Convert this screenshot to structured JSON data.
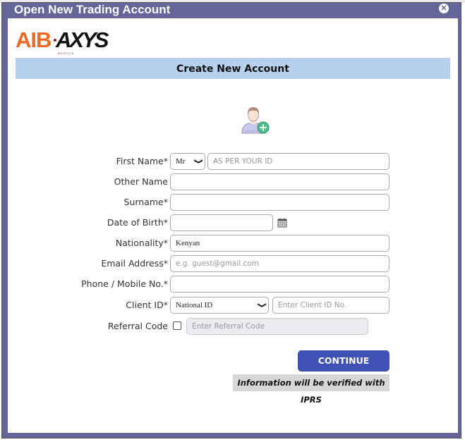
{
  "modal": {
    "title": "Open New Trading Account",
    "close_icon": "close-circle-icon"
  },
  "logo": {
    "part1": "AIB",
    "part2": "AXYS",
    "tagline": "AFRICA",
    "colors": {
      "orange": "#ee6a24",
      "dark": "#111111"
    }
  },
  "header": {
    "title": "Create New Account"
  },
  "avatar": {
    "icon": "add-user-icon"
  },
  "form": {
    "first_name": {
      "label": "First Name*",
      "title_value": "Mr",
      "placeholder": "AS PER YOUR ID",
      "value": ""
    },
    "other_name": {
      "label": "Other Name",
      "value": ""
    },
    "surname": {
      "label": "Surname*",
      "value": ""
    },
    "dob": {
      "label": "Date of Birth*",
      "value": "",
      "icon": "calendar-icon"
    },
    "nationality": {
      "label": "Nationality*",
      "value": "Kenyan"
    },
    "email": {
      "label": "Email Address*",
      "placeholder": "e.g. guest@gmail.com",
      "value": ""
    },
    "phone": {
      "label": "Phone / Mobile No.*",
      "value": ""
    },
    "client_id": {
      "label": "Client ID*",
      "type_value": "National ID",
      "placeholder": "Enter Client ID No.",
      "value": ""
    },
    "referral": {
      "label": "Referral Code",
      "checked": false,
      "placeholder": "Enter Referral Code"
    }
  },
  "actions": {
    "continue_label": "CONTINUE",
    "note": "Information will be verified with IPRS"
  },
  "colors": {
    "frame": "#65659a",
    "header_bg": "#b7d0ee",
    "button": "#3f51b5",
    "note_bg": "#d7d7d7"
  }
}
